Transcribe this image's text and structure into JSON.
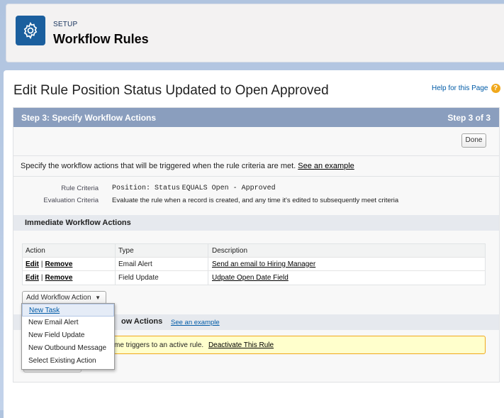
{
  "header": {
    "setup_label": "SETUP",
    "title": "Workflow Rules",
    "icon": "gear-icon"
  },
  "page": {
    "rule_title": "Edit Rule Position Status Updated to Open Approved",
    "help_link": "Help for this Page"
  },
  "step": {
    "title": "Step 3: Specify Workflow Actions",
    "counter": "Step 3 of 3",
    "done_label": "Done"
  },
  "description": {
    "text": "Specify the workflow actions that will be triggered when the rule criteria are met.",
    "example_link": "See an example"
  },
  "criteria": {
    "rule_label": "Rule Criteria",
    "rule_field": "Position: Status",
    "rule_op": "EQUALS Open - Approved",
    "eval_label": "Evaluation Criteria",
    "eval_value": "Evaluate the rule when a record is created, and any time it's edited to subsequently meet criteria"
  },
  "immediate": {
    "heading": "Immediate Workflow Actions",
    "columns": [
      "Action",
      "Type",
      "Description"
    ],
    "rows": [
      {
        "edit": "Edit",
        "sep": "|",
        "remove": "Remove",
        "type": "Email Alert",
        "description": "Send an email to Hiring Manager"
      },
      {
        "edit": "Edit",
        "sep": "|",
        "remove": "Remove",
        "type": "Field Update",
        "description": "Udpate Open Date Field"
      }
    ],
    "add_button": "Add Workflow Action"
  },
  "time_triggered": {
    "heading_partial": "ow Actions",
    "example_link": "See an example",
    "warning_partial": "me triggers to an active rule.",
    "deactivate_link": "Deactivate This Rule",
    "button_partial": "Add Time Trigger"
  },
  "dropdown": {
    "items": [
      "New Task",
      "New Email Alert",
      "New Field Update",
      "New Outbound Message",
      "Select Existing Action"
    ],
    "selected_index": 0
  },
  "colors": {
    "brand_blue": "#1b5f9e",
    "step_bar": "#8a9ebe",
    "warning_bg": "#ffffcc",
    "warning_border": "#f0a81b",
    "link": "#015ba7"
  }
}
